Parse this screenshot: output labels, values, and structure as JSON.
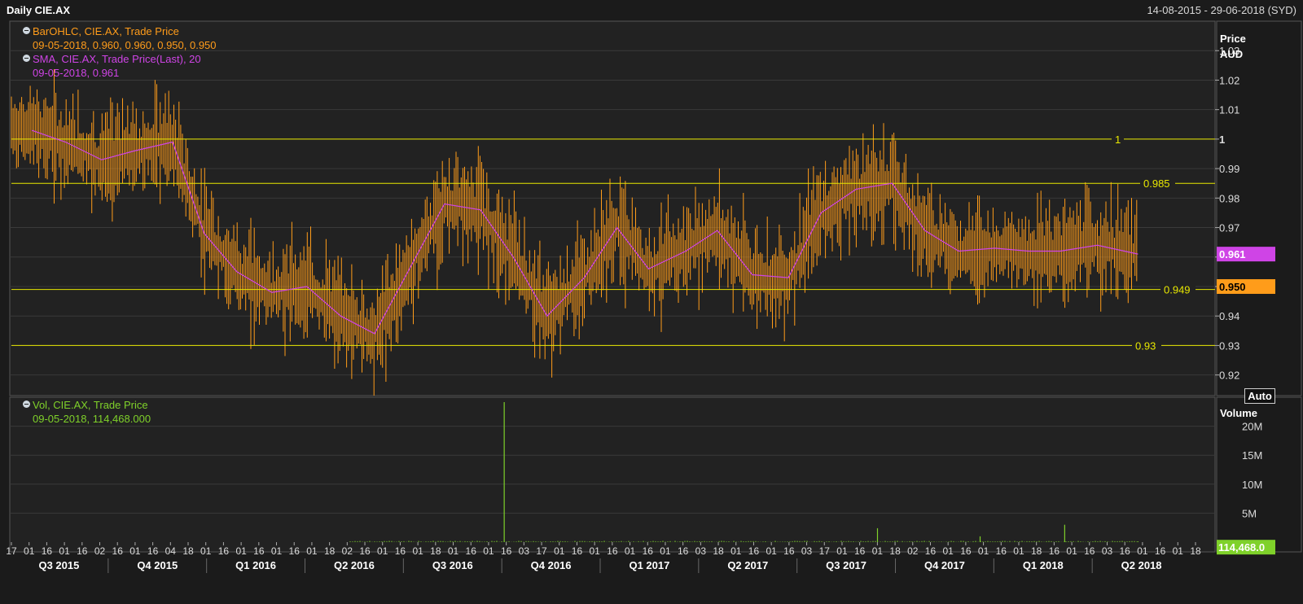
{
  "window": {
    "title": "Daily CIE.AX",
    "date_range": "14-08-2015 - 29-06-2018 (SYD)"
  },
  "price_panel": {
    "legend": [
      {
        "label": "BarOHLC, CIE.AX, Trade Price",
        "values": "09-05-2018, 0.960, 0.960, 0.950, 0.950",
        "color": "#ff9c1a"
      },
      {
        "label": "SMA, CIE.AX, Trade Price(Last),  20",
        "values": "09-05-2018, 0.961",
        "color": "#cf44e6"
      }
    ],
    "axis_title_1": "Price",
    "axis_title_2": "AUD",
    "auto_button": "Auto",
    "ticks": [
      "1.03",
      "1.02",
      "1.01",
      "1",
      "0.99",
      "0.98",
      "0.97",
      "0.96",
      "0.95",
      "0.94",
      "0.93",
      "0.92"
    ],
    "level_lines": [
      {
        "value": 1.0,
        "label": "1"
      },
      {
        "value": 0.985,
        "label": "0.985"
      },
      {
        "value": 0.949,
        "label": "0.949"
      },
      {
        "value": 0.93,
        "label": "0.93"
      }
    ],
    "last_sma_badge": "0.961",
    "last_price_badge": "0.950"
  },
  "volume_panel": {
    "legend": {
      "label": "Vol, CIE.AX, Trade Price",
      "values": "09-05-2018, 114,468.000",
      "color": "#7fd12a"
    },
    "axis_title": "Volume",
    "ticks": [
      "20M",
      "15M",
      "10M",
      "5M"
    ],
    "last_volume_badge": "114,468.0"
  },
  "x_axis": {
    "day_labels": [
      "17",
      "01",
      "16",
      "01",
      "16",
      "02",
      "16",
      "01",
      "16",
      "04",
      "18",
      "01",
      "16",
      "01",
      "16",
      "01",
      "16",
      "01",
      "18",
      "02",
      "16",
      "01",
      "16",
      "01",
      "18",
      "01",
      "16",
      "01",
      "16",
      "03",
      "17",
      "01",
      "16",
      "01",
      "16",
      "01",
      "16",
      "01",
      "16",
      "03",
      "18",
      "01",
      "16",
      "01",
      "16",
      "03",
      "17",
      "01",
      "16",
      "01",
      "18",
      "02",
      "16",
      "01",
      "16",
      "01",
      "16",
      "01",
      "18",
      "16",
      "01",
      "16",
      "03",
      "16",
      "01",
      "16",
      "01",
      "18"
    ],
    "quarter_labels": [
      "Q3 2015",
      "Q4 2015",
      "Q1 2016",
      "Q2 2016",
      "Q3 2016",
      "Q4 2016",
      "Q1 2017",
      "Q2 2017",
      "Q3 2017",
      "Q4 2017",
      "Q1 2018",
      "Q2 2018"
    ]
  },
  "colors": {
    "background": "#1b1b1b",
    "plot": "#222222",
    "grid": "#3a3a3a",
    "ohlc": "#ff9c1a",
    "sma": "#cf44e6",
    "volume": "#7fd12a",
    "level": "#e8e800"
  },
  "chart_data": [
    {
      "type": "line",
      "title": "Daily CIE.AX",
      "ylabel": "Price AUD",
      "ylim": [
        0.913,
        1.04
      ],
      "grid": true,
      "series": [
        {
          "name": "SMA, CIE.AX, Trade Price(Last),  20",
          "x": [
            "2015-09-01",
            "2015-10-01",
            "2015-11-02",
            "2015-12-01",
            "2016-01-04",
            "2016-02-01",
            "2016-03-01",
            "2016-04-01",
            "2016-05-02",
            "2016-06-01",
            "2016-07-01",
            "2016-08-01",
            "2016-09-01",
            "2016-10-03",
            "2016-11-01",
            "2016-12-01",
            "2017-01-03",
            "2017-02-01",
            "2017-03-01",
            "2017-04-03",
            "2017-05-01",
            "2017-06-01",
            "2017-07-03",
            "2017-08-01",
            "2017-09-01",
            "2017-10-03",
            "2017-11-01",
            "2017-12-01",
            "2018-01-02",
            "2018-02-01",
            "2018-03-01",
            "2018-04-03",
            "2018-05-09"
          ],
          "values": [
            1.003,
            0.999,
            0.993,
            0.996,
            0.999,
            0.968,
            0.955,
            0.948,
            0.95,
            0.94,
            0.934,
            0.956,
            0.978,
            0.976,
            0.96,
            0.94,
            0.953,
            0.97,
            0.956,
            0.962,
            0.969,
            0.954,
            0.953,
            0.975,
            0.983,
            0.985,
            0.969,
            0.962,
            0.963,
            0.962,
            0.962,
            0.964,
            0.961
          ]
        }
      ],
      "ohlc_last": {
        "date": "09-05-2018",
        "open": 0.96,
        "high": 0.96,
        "low": 0.95,
        "close": 0.95
      }
    },
    {
      "type": "bar",
      "title": "Vol, CIE.AX, Trade Price",
      "ylabel": "Volume",
      "ylim": [
        0,
        25000000
      ],
      "series": [
        {
          "name": "Vol, CIE.AX, Trade Price",
          "x": [
            "2016-10-24",
            "2017-09-20",
            "2017-12-20",
            "2018-03-05",
            "2018-05-09"
          ],
          "values": [
            30500000,
            2400000,
            1000000,
            3000000,
            114468
          ]
        }
      ]
    }
  ]
}
